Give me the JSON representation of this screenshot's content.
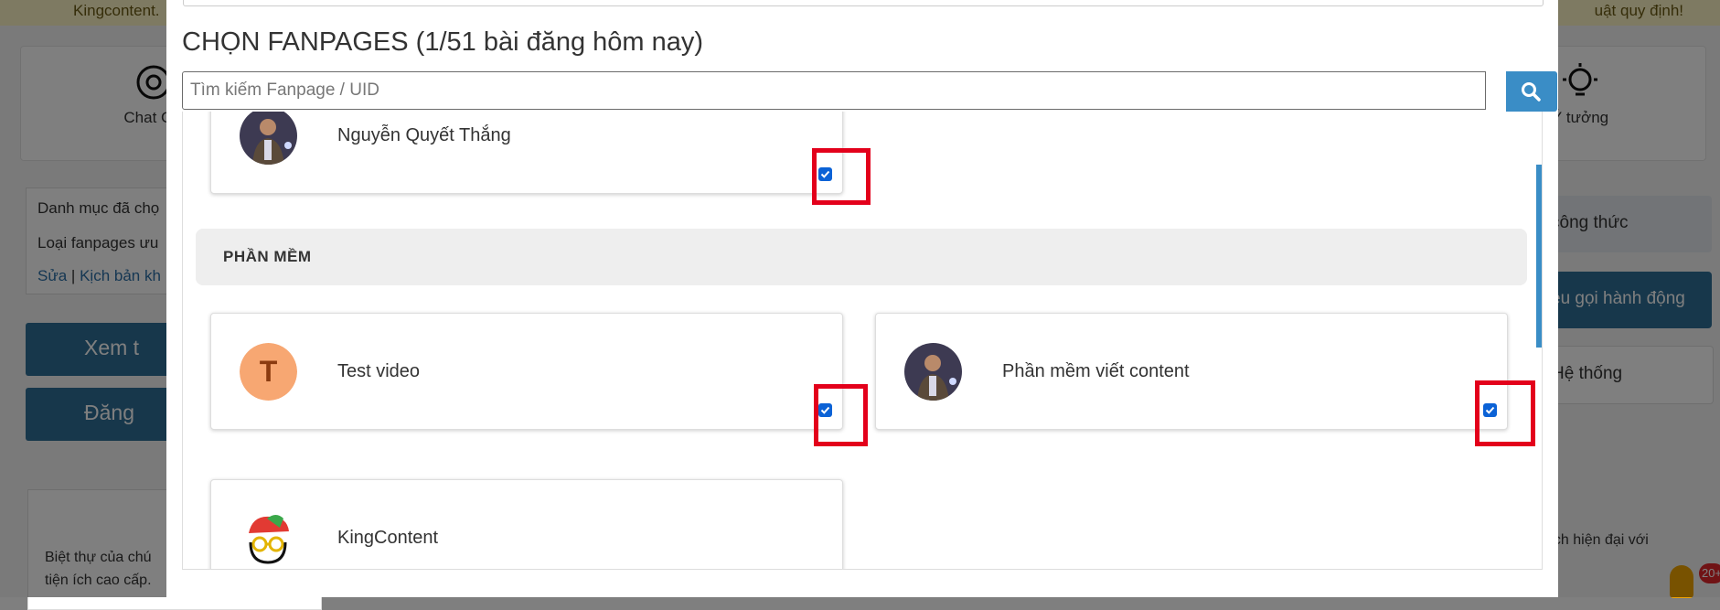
{
  "background": {
    "topbar_left": "Kingcontent.",
    "topbar_right": "uật quy định!",
    "tool_left": "Chat GP",
    "tool_right": "Ý tưởng",
    "left_card": {
      "line1": "Danh mục đã chọ",
      "line2": "Loại fanpages ưu",
      "edit_link": "Sửa",
      "separator": "|",
      "script_link": "Kịch bản kh"
    },
    "btn_view": "Xem t",
    "btn_post": "Đăng",
    "post_text_1": "Biệt thự của chú",
    "post_text_2": "tiện ích cao cấp.",
    "right_btn_formula": "công thức",
    "right_btn_cta": "ệu gọi hành động",
    "right_btn_system": "Hệ thống",
    "right_text": "ách hiện đại với",
    "notif_count": "20+"
  },
  "modal": {
    "title": "CHỌN FANPAGES (1/51 bài đăng hôm nay)",
    "search_placeholder": "Tìm kiếm Fanpage / UID",
    "category": "PHẦN MỀM",
    "pages": [
      {
        "name": "Nguyễn Quyết Thắng",
        "checked": true,
        "avatar": "photo"
      },
      {
        "name": "Test video",
        "checked": true,
        "avatar": "T"
      },
      {
        "name": "Phần mềm viết content",
        "checked": true,
        "avatar": "photo"
      },
      {
        "name": "KingContent",
        "checked": false,
        "avatar": "logo"
      }
    ]
  },
  "colors": {
    "accent": "#3a8dc6",
    "checkbox": "#0b62d6",
    "highlight": "#e3001b",
    "avatar_t": "#f7a772"
  }
}
